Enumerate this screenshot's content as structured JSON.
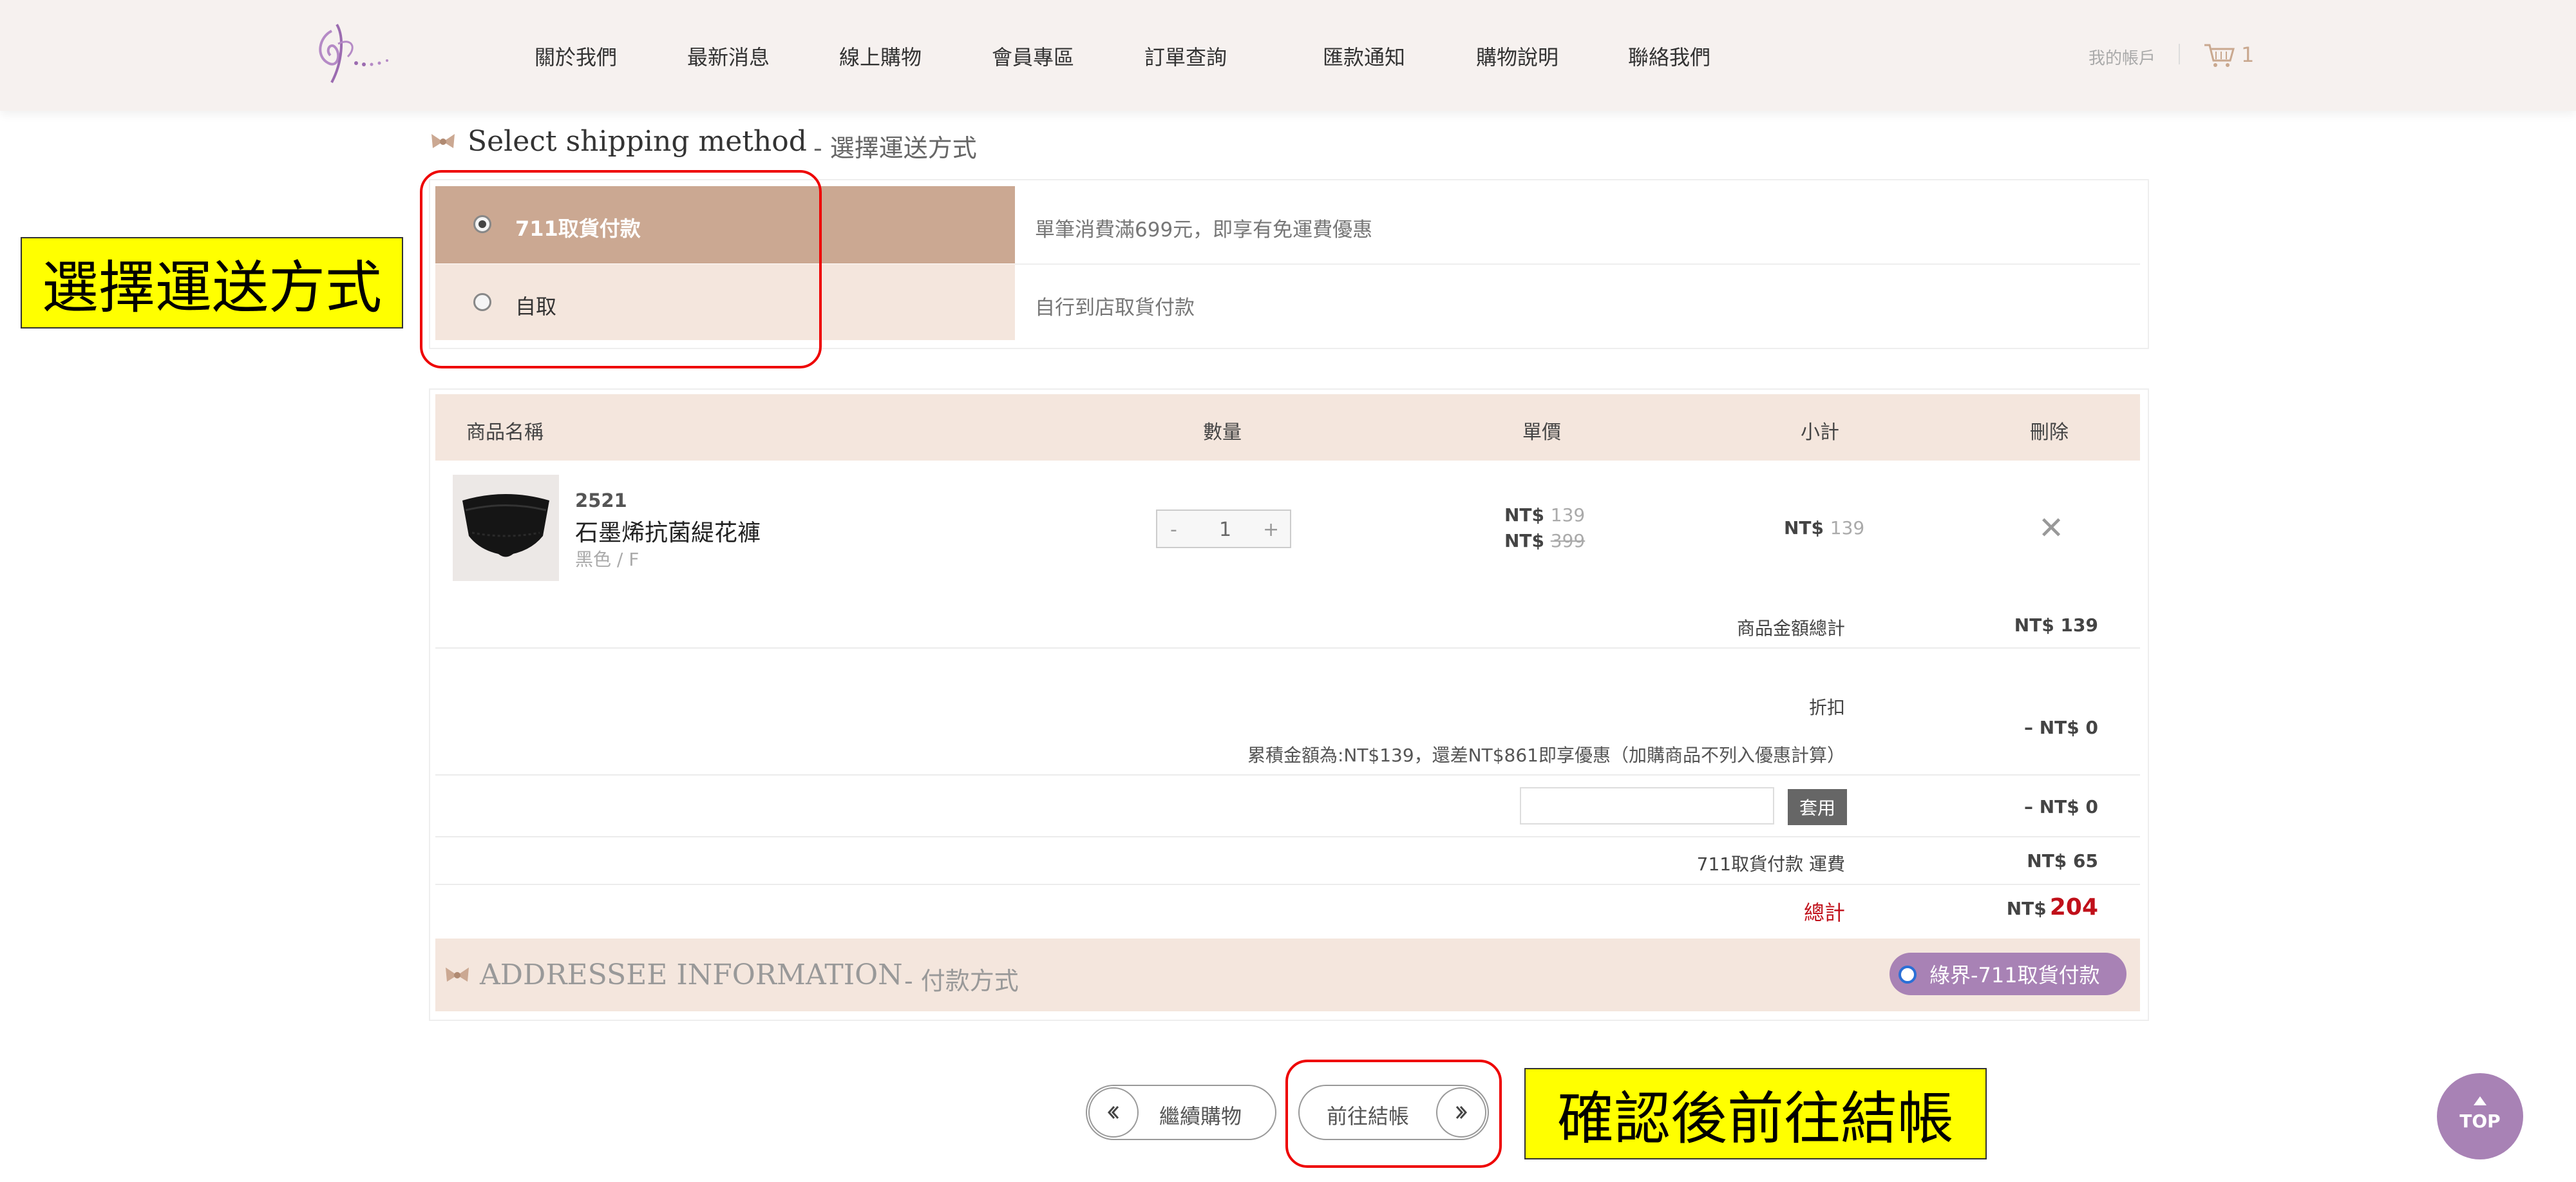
{
  "header": {
    "nav": [
      "關於我們",
      "最新消息",
      "線上購物",
      "會員專區",
      "訂單查詢",
      "匯款通知",
      "購物說明",
      "聯絡我們"
    ],
    "account": "我的帳戶",
    "cart_count": "1"
  },
  "shipping": {
    "title_en": "Select shipping method",
    "title_zh": "- 選擇運送方式",
    "options": [
      {
        "label": "711取貨付款",
        "desc": "單筆消費滿699元，即享有免運費優惠",
        "selected": true
      },
      {
        "label": "自取",
        "desc": "自行到店取貨付款",
        "selected": false
      }
    ]
  },
  "annotations": {
    "shipping_note": "選擇運送方式",
    "checkout_note": "確認後前往結帳"
  },
  "cart": {
    "headers": [
      "商品名稱",
      "數量",
      "單價",
      "小計",
      "刪除"
    ],
    "item": {
      "code": "2521",
      "name": "石墨烯抗菌緹花褲",
      "variant": "黑色 / F",
      "qty": "1",
      "qty_minus": "-",
      "qty_plus": "+",
      "price_currency": "NT$",
      "price": "139",
      "orig_currency": "NT$",
      "orig_price": "399",
      "subtotal_currency": "NT$",
      "subtotal": "139",
      "delete": "✕"
    },
    "summary": {
      "goods_total_label": "商品金額總計",
      "goods_total": "NT$ 139",
      "discount_label": "折扣",
      "discount": "– NT$ 0",
      "discount_note": "累積金額為:NT$139，還差NT$861即享優惠（加購商品不列入優惠計算）",
      "coupon_button": "套用",
      "coupon_value": "– NT$ 0",
      "shipping_label": "711取貨付款 運費",
      "shipping_fee": "NT$ 65",
      "total_label": "總計",
      "total_currency": "NT$",
      "total": "204"
    }
  },
  "addressee": {
    "title_en": "ADDRESSEE INFORMATION",
    "title_zh": "- 付款方式",
    "payment": "綠界-711取貨付款"
  },
  "buttons": {
    "continue": "繼續購物",
    "checkout": "前往結帳"
  },
  "top_button": "TOP",
  "colors": {
    "accent_tan": "#cba892",
    "light_peach": "#f4e6dd",
    "purple": "#a882b5",
    "total_red": "#c0101a"
  }
}
